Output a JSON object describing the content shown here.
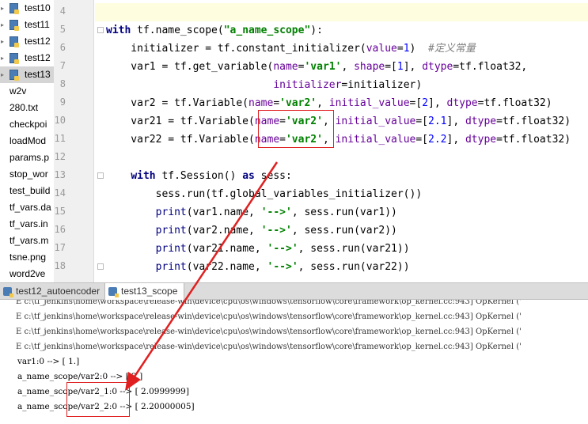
{
  "sidebar": {
    "items": [
      {
        "label": "test10",
        "type": "py"
      },
      {
        "label": "test11",
        "type": "py"
      },
      {
        "label": "test12",
        "type": "py"
      },
      {
        "label": "test12",
        "type": "py"
      },
      {
        "label": "test13",
        "type": "py",
        "selected": true
      },
      {
        "label": "w2v",
        "type": "plain"
      },
      {
        "label": "280.txt",
        "type": "plain"
      },
      {
        "label": "checkpoi",
        "type": "plain"
      },
      {
        "label": "loadMod",
        "type": "plain"
      },
      {
        "label": "params.p",
        "type": "plain"
      },
      {
        "label": "stop_wor",
        "type": "plain"
      },
      {
        "label": "test_build",
        "type": "plain"
      },
      {
        "label": "tf_vars.da",
        "type": "plain"
      },
      {
        "label": "tf_vars.in",
        "type": "plain"
      },
      {
        "label": "tf_vars.m",
        "type": "plain"
      },
      {
        "label": "tsne.png",
        "type": "plain"
      },
      {
        "label": "word2ve",
        "type": "plain"
      }
    ]
  },
  "editor": {
    "line_numbers": [
      "4",
      "5",
      "6",
      "7",
      "8",
      "9",
      "10",
      "11",
      "12",
      "13",
      "14",
      "15",
      "16",
      "17",
      "18"
    ],
    "lines": {
      "l5": {
        "kw": "with",
        "a": " tf.name_scope(",
        "s": "\"a_name_scope\"",
        "b": "):"
      },
      "l6": {
        "a": "    initializer = tf.constant_initializer(",
        "kw1": "value",
        "b": "=",
        "n": "1",
        "c": ")  ",
        "cm": "#定义常量"
      },
      "l7": {
        "a": "    var1 = tf.get_variable(",
        "kw1": "name",
        "b": "=",
        "s": "'var1'",
        "c": ", ",
        "kw2": "shape",
        "d": "=[",
        "n": "1",
        "e": "], ",
        "kw3": "dtype",
        "f": "=tf.float32,"
      },
      "l8": {
        "a": "                           ",
        "kw1": "initializer",
        "b": "=initializer)"
      },
      "l9": {
        "a": "    var2 = tf.Variable(",
        "kw1": "name",
        "b": "=",
        "s": "'var2'",
        "c": ", ",
        "kw2": "initial_value",
        "d": "=[",
        "n": "2",
        "e": "], ",
        "kw3": "dtype",
        "f": "=tf.float32)"
      },
      "l10": {
        "a": "    var21 = tf.Variable(",
        "kw1": "name",
        "b": "=",
        "s": "'var2'",
        "c": ", ",
        "kw2": "initial_value",
        "d": "=[",
        "n": "2.1",
        "e": "], ",
        "kw3": "dtype",
        "f": "=tf.float32)"
      },
      "l11": {
        "a": "    var22 = tf.Variable(",
        "kw1": "name",
        "b": "=",
        "s": "'var2'",
        "c": ", ",
        "kw2": "initial_value",
        "d": "=[",
        "n": "2.2",
        "e": "], ",
        "kw3": "dtype",
        "f": "=tf.float32)"
      },
      "l13": {
        "a": "    ",
        "kw": "with",
        "b": " tf.Session() ",
        "kw2": "as",
        "c": " sess:"
      },
      "l14": {
        "a": "        sess.run(tf.global_variables_initializer())"
      },
      "l15": {
        "a": "        ",
        "p": "print",
        "b": "(var1.name, ",
        "s": "'-->'",
        "c": ", sess.run(var1))"
      },
      "l16": {
        "a": "        ",
        "p": "print",
        "b": "(var2.name, ",
        "s": "'-->'",
        "c": ", sess.run(var2))"
      },
      "l17": {
        "a": "        ",
        "p": "print",
        "b": "(var21.name, ",
        "s": "'-->'",
        "c": ", sess.run(var21))"
      },
      "l18": {
        "a": "        ",
        "p": "print",
        "b": "(var22.name, ",
        "s": "'-->'",
        "c": ", sess.run(var22))"
      }
    }
  },
  "tabs": [
    {
      "label": "test12_autoencoder",
      "active": false
    },
    {
      "label": "test13_scope",
      "active": true
    }
  ],
  "console": {
    "errors": [
      "E c:\\tf_jenkins\\home\\workspace\\release-win\\device\\cpu\\os\\windows\\tensorflow\\core\\framework\\op_kernel.cc:943] OpKernel ('",
      "E c:\\tf_jenkins\\home\\workspace\\release-win\\device\\cpu\\os\\windows\\tensorflow\\core\\framework\\op_kernel.cc:943] OpKernel ('",
      "E c:\\tf_jenkins\\home\\workspace\\release-win\\device\\cpu\\os\\windows\\tensorflow\\core\\framework\\op_kernel.cc:943] OpKernel ('",
      "E c:\\tf_jenkins\\home\\workspace\\release-win\\device\\cpu\\os\\windows\\tensorflow\\core\\framework\\op_kernel.cc:943] OpKernel ('"
    ],
    "results": [
      "var1:0 --> [ 1.]",
      "a_name_scope/var2:0 --> [ 2.]",
      "a_name_scope/var2_1:0 --> [ 2.0999999]",
      "a_name_scope/var2_2:0 --> [ 2.20000005]"
    ]
  },
  "colors": {
    "annotation": "#e02020",
    "keyword": "#000080",
    "string": "#008000",
    "kwarg": "#660099",
    "number": "#0000ff",
    "comment": "#808080"
  }
}
